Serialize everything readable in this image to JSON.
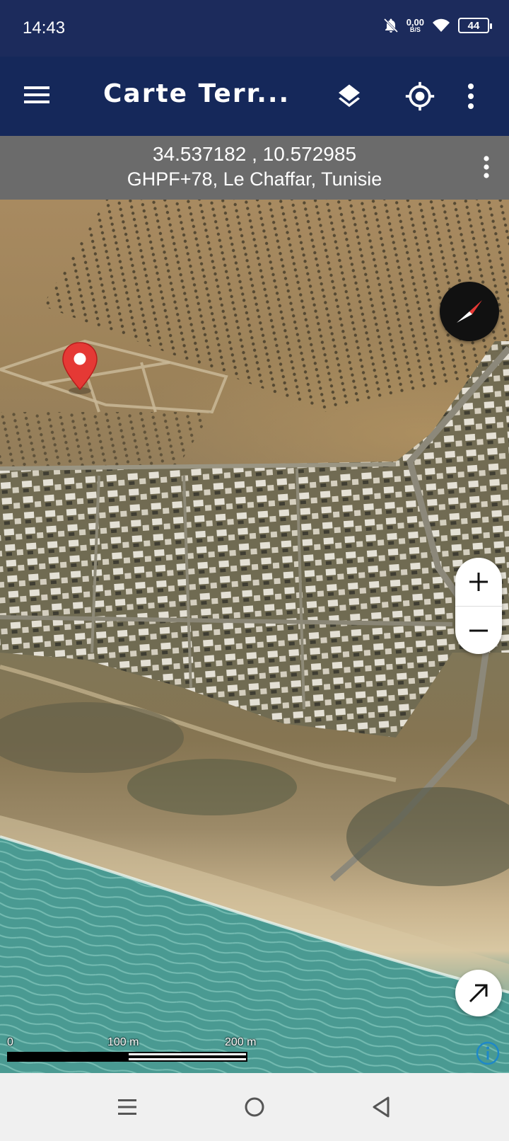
{
  "status_bar": {
    "time": "14:43",
    "net_speed_value": "0,00",
    "net_speed_unit": "B/S",
    "battery": "44",
    "icons": [
      "bell-off-icon",
      "wifi-icon",
      "battery-icon"
    ]
  },
  "app_bar": {
    "title": "Carte Terr...",
    "icons": [
      "menu-icon",
      "layers-icon",
      "my-location-icon",
      "more-vert-icon"
    ]
  },
  "location": {
    "coordinates": "34.537182 , 10.572985",
    "address": "GHPF+78, Le Chaffar, Tunisie"
  },
  "map": {
    "scale_labels": [
      "0",
      "100 m",
      "200 m"
    ],
    "controls": [
      "compass-icon",
      "zoom-in-icon",
      "zoom-out-icon",
      "direction-arrow-icon",
      "info-icon"
    ],
    "marker_color": "#e53935"
  },
  "nav_bar": {
    "icons": [
      "recents-icon",
      "home-icon",
      "back-icon"
    ]
  },
  "colors": {
    "status_bar": "#1c2b5c",
    "app_bar": "#15285a",
    "coord_banner": "#6b6b6b"
  }
}
